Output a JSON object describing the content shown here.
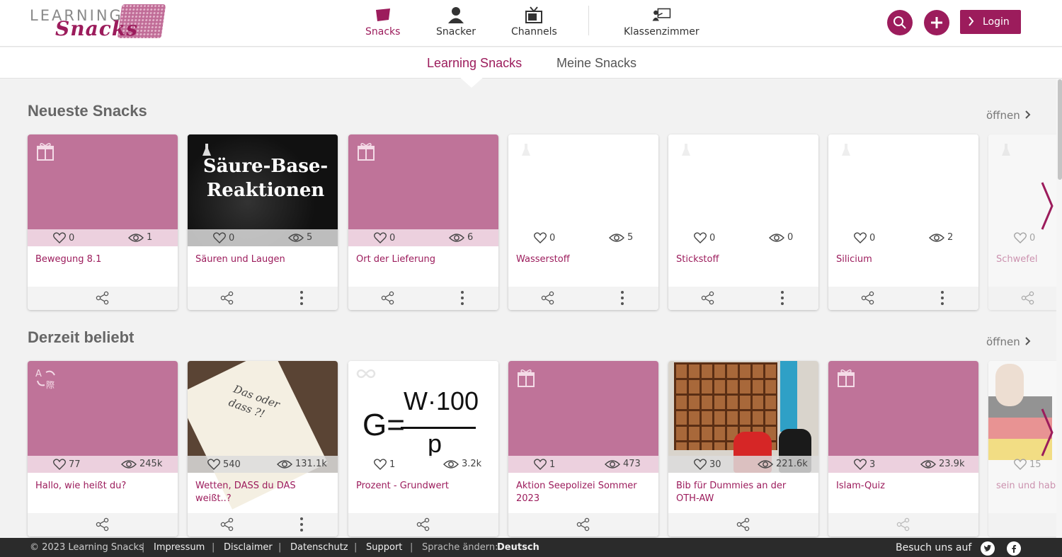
{
  "brand": {
    "learning": "LEARNING",
    "snacks": "Snacks",
    "primary": "#9c1c5c",
    "card_pink": "#bf7399"
  },
  "nav": {
    "snacks": "Snacks",
    "snacker": "Snacker",
    "channels": "Channels",
    "klassenzimmer": "Klassenzimmer",
    "login": "Login"
  },
  "subnav": {
    "tab1": "Learning Snacks",
    "tab2": "Meine Snacks"
  },
  "sections": {
    "neueste": {
      "title": "Neueste Snacks",
      "open": "öffnen"
    },
    "beliebt": {
      "title": "Derzeit beliebt",
      "open": "öffnen"
    }
  },
  "neueste_cards": [
    {
      "title": "Bewegung 8.1",
      "likes": "0",
      "views": "1"
    },
    {
      "title": "Säuren und Laugen",
      "likes": "0",
      "views": "5",
      "image_text_1": "Säure-Base-",
      "image_text_2": "Reaktionen"
    },
    {
      "title": "Ort der Lieferung",
      "likes": "0",
      "views": "6"
    },
    {
      "title": "Wasserstoff",
      "likes": "0",
      "views": "5"
    },
    {
      "title": "Stickstoff",
      "likes": "0",
      "views": "0"
    },
    {
      "title": "Silicium",
      "likes": "0",
      "views": "2"
    },
    {
      "title": "Schwefel",
      "likes": "0"
    }
  ],
  "beliebt_cards": [
    {
      "title": "Hallo, wie heißt du?",
      "likes": "77",
      "views": "245k"
    },
    {
      "title": "Wetten, DASS du DAS weißt..?",
      "likes": "540",
      "views": "131.1k",
      "image_text_1": "Das oder",
      "image_text_2": "dass ?!"
    },
    {
      "title": "Prozent - Grundwert",
      "likes": "1",
      "views": "3.2k",
      "formula_g": "G=",
      "formula_num": "W·100",
      "formula_den": "p"
    },
    {
      "title": "Aktion Seepolizei Sommer 2023",
      "likes": "1",
      "views": "473"
    },
    {
      "title": "Bib für Dummies an der OTH-AW",
      "likes": "30",
      "views": "221.6k"
    },
    {
      "title": "Islam-Quiz",
      "likes": "3",
      "views": "23.9k"
    },
    {
      "title": "sein und habe",
      "likes": "15"
    }
  ],
  "footer": {
    "copyright": "© 2023 Learning Snacks",
    "impressum": "Impressum",
    "disclaimer": "Disclaimer",
    "datenschutz": "Datenschutz",
    "support": "Support",
    "sprache_label": "Sprache ändern:",
    "sprache_value": "Deutsch",
    "besuch": "Besuch uns auf"
  }
}
